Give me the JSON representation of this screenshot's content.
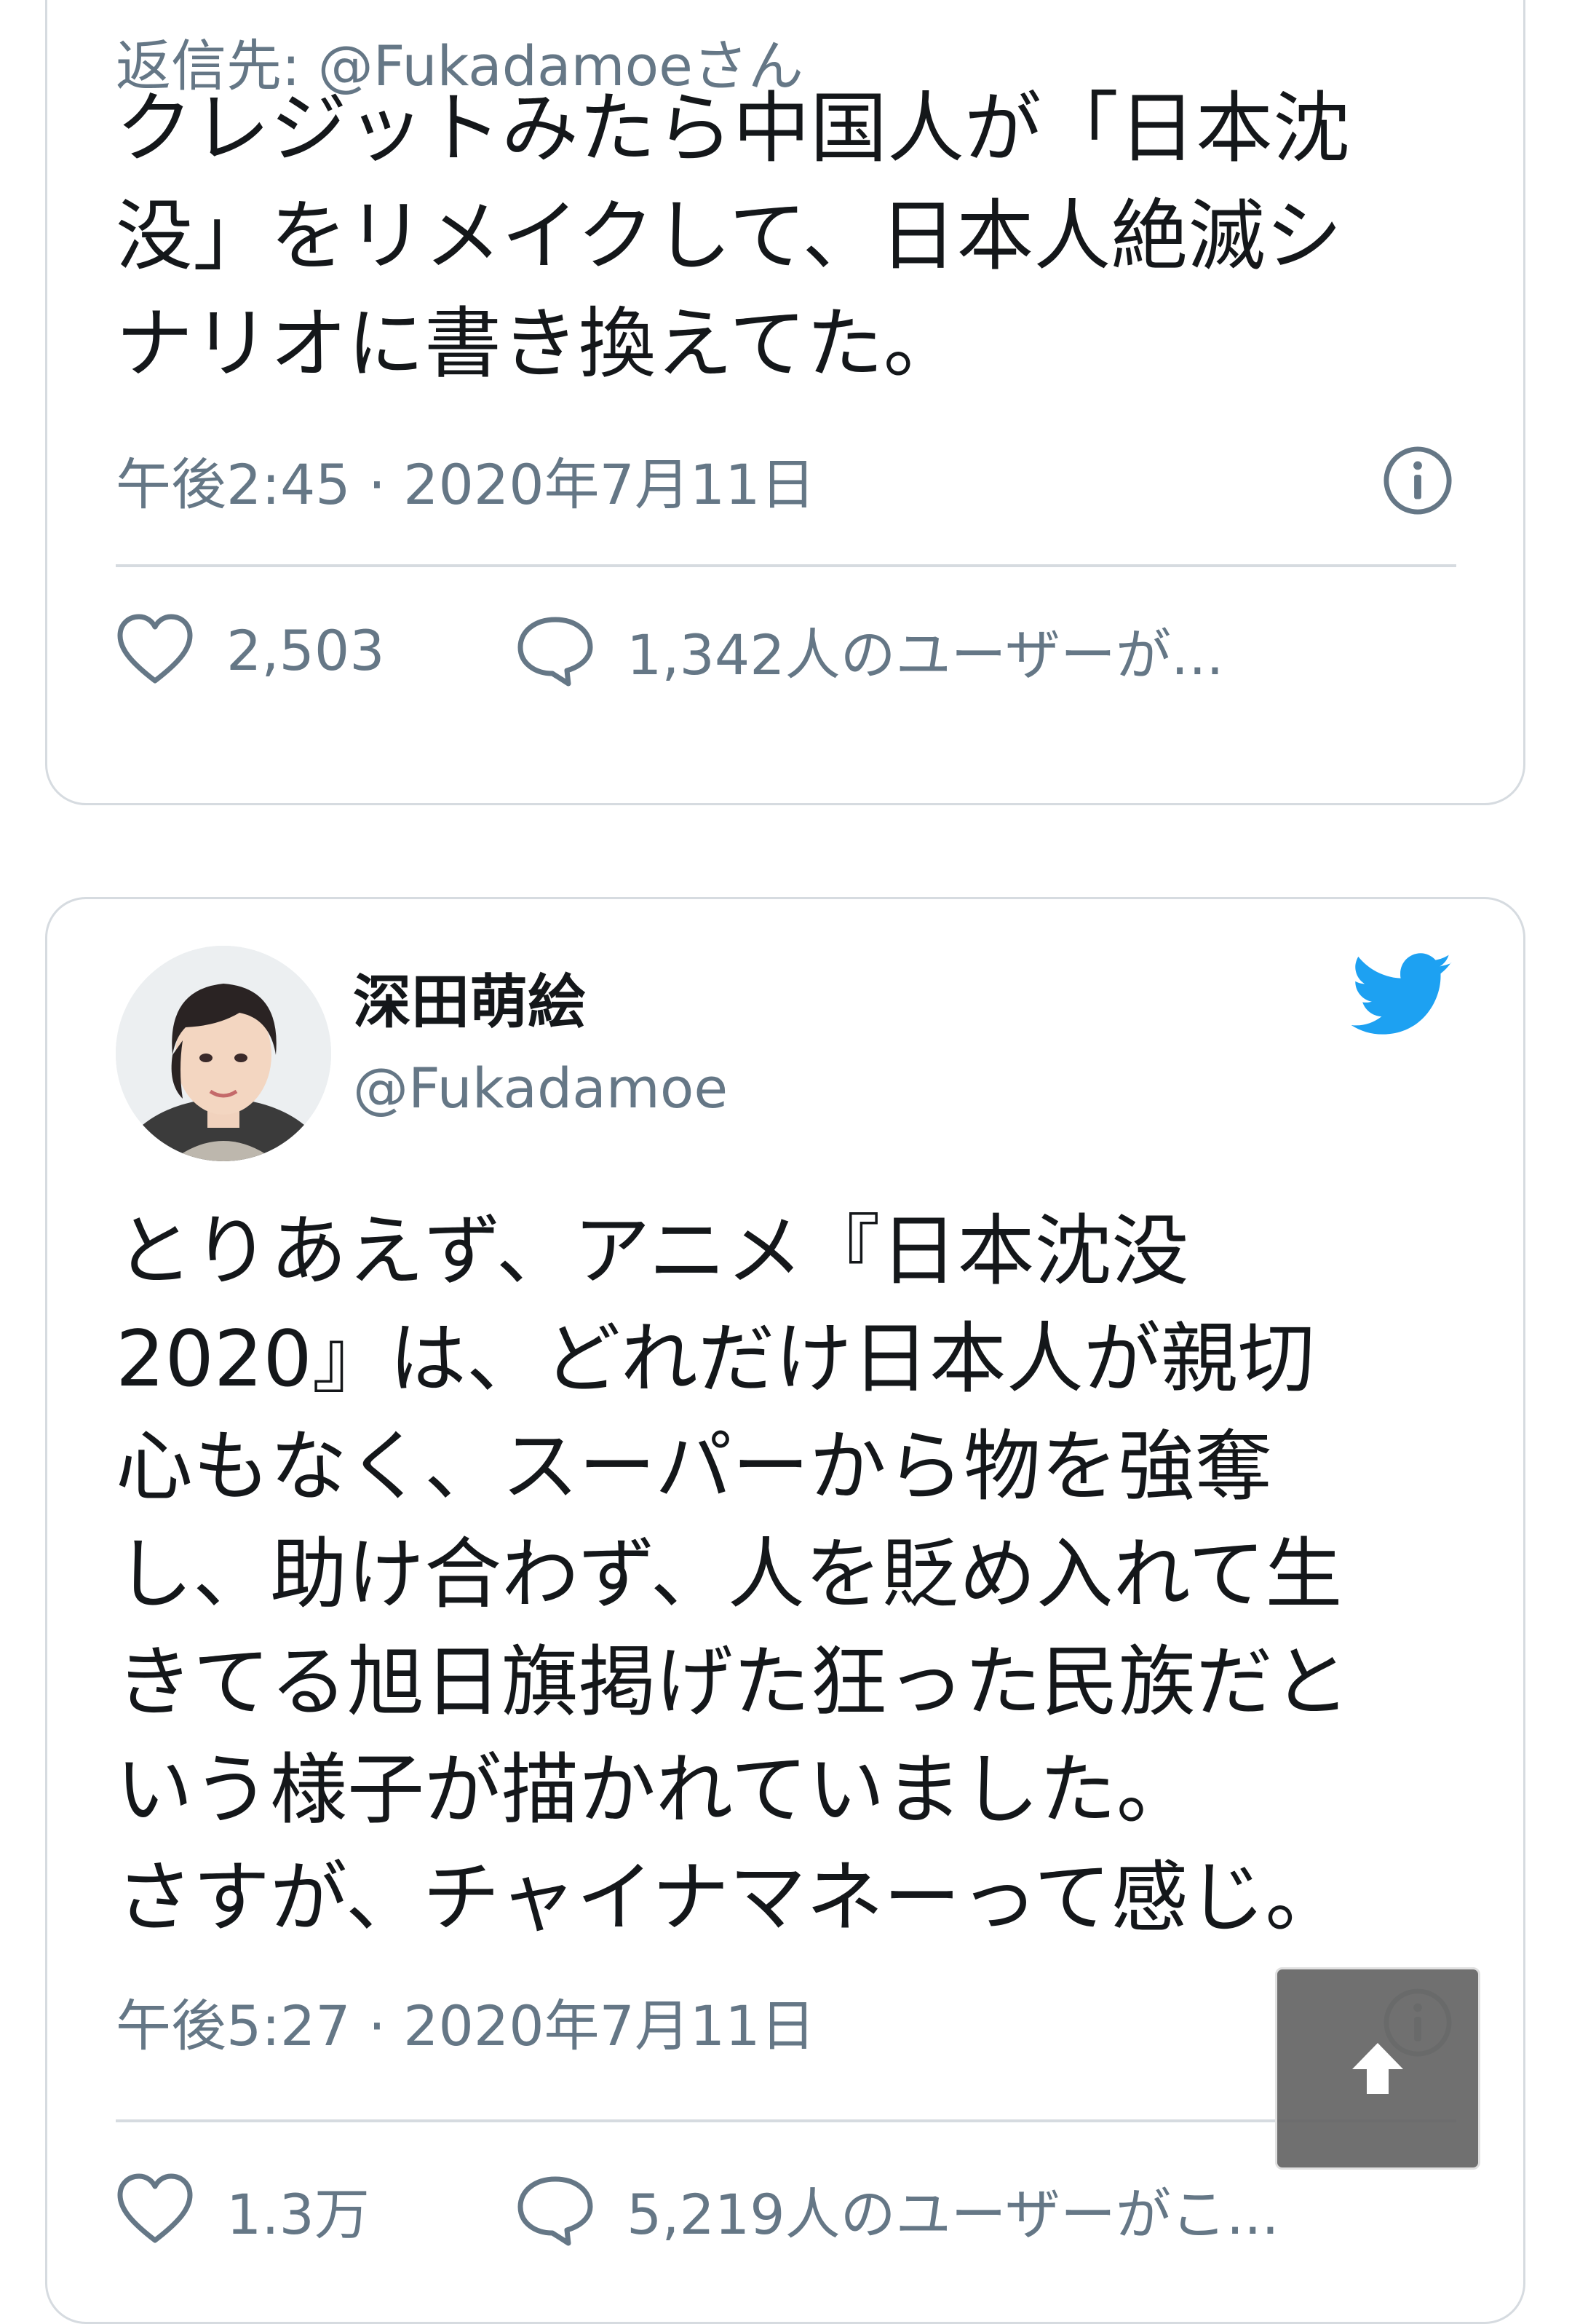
{
  "colors": {
    "secondary_text": "#657786",
    "primary_text": "#14171a",
    "border": "#d6dbe0",
    "twitter_blue": "#1da1f2"
  },
  "tweet1": {
    "reply_to": "返信先: @Fukadamoeさん",
    "text": "クレジットみたら中国人が「日本沈\n没」をリメイクして、日本人絶滅シ\nナリオに書き換えてた。",
    "timestamp": "午後2:45 · 2020年7月11日",
    "likes": "2,503",
    "replies": "1,342人のユーザーが...",
    "info_icon": "info-icon",
    "like_icon": "heart-icon",
    "reply_icon": "speech-bubble-icon"
  },
  "tweet2": {
    "display_name": "深田萌絵",
    "handle": "@Fukadamoe",
    "text": "とりあえず、アニメ『日本沈没\n2020』は、どれだけ日本人が親切\n心もなく、スーパーから物を強奪\nし、助け合わず、人を貶め入れて生\nきてる旭日旗掲げた狂った民族だと\nいう様子が描かれていました。\nさすが、チャイナマネーって感じ。",
    "timestamp": "午後5:27 · 2020年7月11日",
    "likes": "1.3万",
    "replies": "5,219人のユーザーがこ...",
    "avatar_icon": "avatar",
    "platform_icon": "twitter-bird-icon",
    "info_icon": "info-icon",
    "like_icon": "heart-icon",
    "reply_icon": "speech-bubble-icon"
  },
  "overlay": {
    "scroll_top_icon": "arrow-up-icon"
  }
}
